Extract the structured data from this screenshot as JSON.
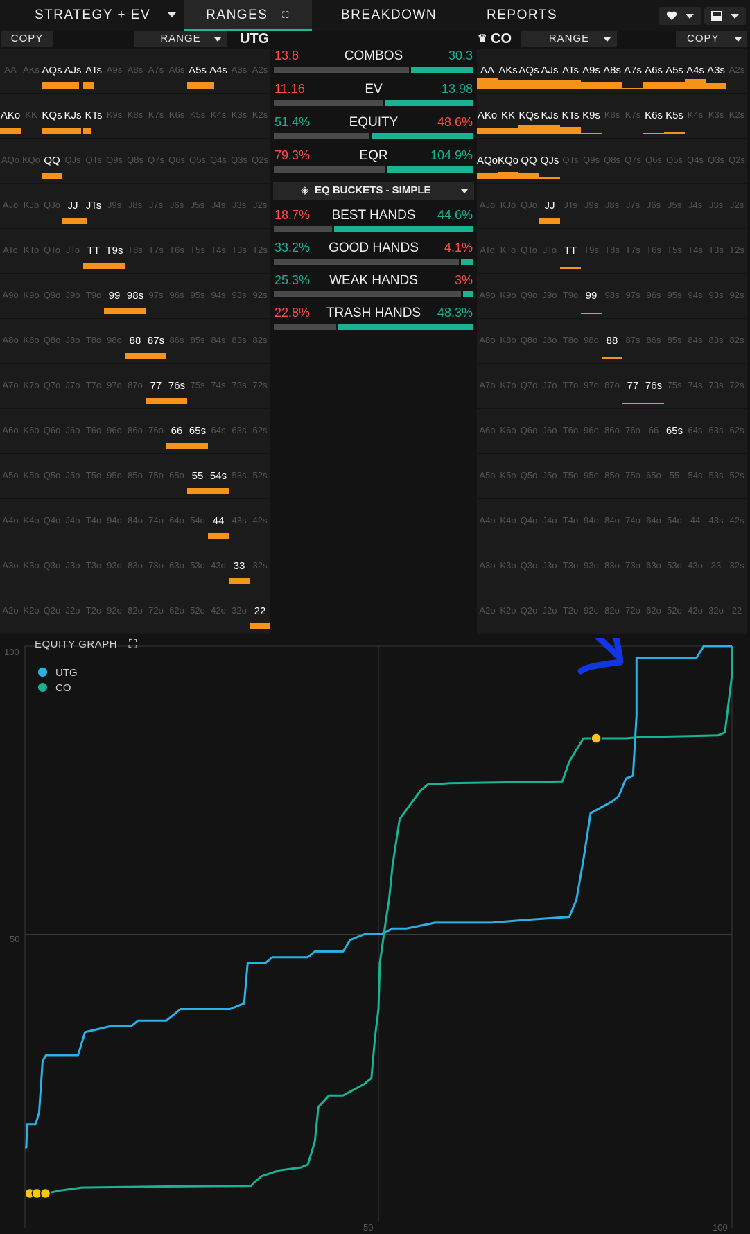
{
  "nav": {
    "tabs": [
      {
        "label": "STRATEGY + EV",
        "dropdown": true
      },
      {
        "label": "RANGES",
        "active": true
      },
      {
        "label": "BREAKDOWN"
      },
      {
        "label": "REPORTS"
      }
    ],
    "icons": [
      "heart-icon",
      "layout-icon"
    ]
  },
  "left": {
    "copy_label": "COPY",
    "range_label": "RANGE",
    "position": "UTG"
  },
  "right": {
    "copy_label": "COPY",
    "range_label": "RANGE",
    "position": "CO",
    "crown": "♛"
  },
  "hands": [
    [
      "AA",
      "AKs",
      "AQs",
      "AJs",
      "ATs",
      "A9s",
      "A8s",
      "A7s",
      "A6s",
      "A5s",
      "A4s",
      "A3s",
      "A2s"
    ],
    [
      "AKo",
      "KK",
      "KQs",
      "KJs",
      "KTs",
      "K9s",
      "K8s",
      "K7s",
      "K6s",
      "K5s",
      "K4s",
      "K3s",
      "K2s"
    ],
    [
      "AQo",
      "KQo",
      "QQ",
      "QJs",
      "QTs",
      "Q9s",
      "Q8s",
      "Q7s",
      "Q6s",
      "Q5s",
      "Q4s",
      "Q3s",
      "Q2s"
    ],
    [
      "AJo",
      "KJo",
      "QJo",
      "JJ",
      "JTs",
      "J9s",
      "J8s",
      "J7s",
      "J6s",
      "J5s",
      "J4s",
      "J3s",
      "J2s"
    ],
    [
      "ATo",
      "KTo",
      "QTo",
      "JTo",
      "TT",
      "T9s",
      "T8s",
      "T7s",
      "T6s",
      "T5s",
      "T4s",
      "T3s",
      "T2s"
    ],
    [
      "A9o",
      "K9o",
      "Q9o",
      "J9o",
      "T9o",
      "99",
      "98s",
      "97s",
      "96s",
      "95s",
      "94s",
      "93s",
      "92s"
    ],
    [
      "A8o",
      "K8o",
      "Q8o",
      "J8o",
      "T8o",
      "98o",
      "88",
      "87s",
      "86s",
      "85s",
      "84s",
      "83s",
      "82s"
    ],
    [
      "A7o",
      "K7o",
      "Q7o",
      "J7o",
      "T7o",
      "97o",
      "87o",
      "77",
      "76s",
      "75s",
      "74s",
      "73s",
      "72s"
    ],
    [
      "A6o",
      "K6o",
      "Q6o",
      "J6o",
      "T6o",
      "96o",
      "86o",
      "76o",
      "66",
      "65s",
      "64s",
      "63s",
      "62s"
    ],
    [
      "A5o",
      "K5o",
      "Q5o",
      "J5o",
      "T5o",
      "95o",
      "85o",
      "75o",
      "65o",
      "55",
      "54s",
      "53s",
      "52s"
    ],
    [
      "A4o",
      "K4o",
      "Q4o",
      "J4o",
      "T4o",
      "94o",
      "84o",
      "74o",
      "64o",
      "54o",
      "44",
      "43s",
      "42s"
    ],
    [
      "A3o",
      "K3o",
      "Q3o",
      "J3o",
      "T3o",
      "93o",
      "83o",
      "73o",
      "63o",
      "53o",
      "43o",
      "33",
      "32s"
    ],
    [
      "A2o",
      "K2o",
      "Q2o",
      "J2o",
      "T2o",
      "92o",
      "82o",
      "72o",
      "62o",
      "52o",
      "42o",
      "32o",
      "22"
    ]
  ],
  "utg_range": {
    "AQs": 1,
    "AJs": 0.8,
    "ATs": 0.5,
    "A5s": 1,
    "A4s": 0.3,
    "AKo": 1,
    "KQs": 1,
    "KJs": 0.9,
    "KTs": 0.4,
    "QQ": 1,
    "JJ": 1,
    "JTs": 0.2,
    "TT": 1,
    "T9s": 1,
    "99": 1,
    "98s": 1,
    "88": 1,
    "87s": 1,
    "77": 1,
    "76s": 1,
    "66": 1,
    "65s": 1,
    "55": 1,
    "54s": 1,
    "44": 1,
    "33": 1,
    "22": 1
  },
  "co_range": {
    "AA": 0.6,
    "AKs": 0.45,
    "AQs": 0.45,
    "AJs": 0.45,
    "ATs": 0.45,
    "A9s": 0.4,
    "A8s": 0.4,
    "A7s": 0.05,
    "A6s": 0.4,
    "A5s": 0.35,
    "A4s": 0.55,
    "A3s": 0.3,
    "AKo": 0.3,
    "KK": 0.3,
    "KQs": 0.45,
    "KJs": 0.45,
    "KTs": 0.4,
    "K9s": 0.05,
    "K6s": 0.05,
    "K5s": 0.1,
    "AQo": 0.3,
    "KQo": 0.4,
    "QQ": 0.3,
    "QJs": 0.1,
    "JJ": 0.3,
    "TT": 0.1,
    "99": 0.05,
    "88": 0.1,
    "77": 0.04,
    "76s": 0.04,
    "65s": 0.02
  },
  "stats": [
    {
      "left": "13.8",
      "label": "COMBOS",
      "right": "30.3",
      "lc": "red",
      "rc": "green",
      "fill": 0.31
    },
    {
      "left": "11.16",
      "label": "EV",
      "right": "13.98",
      "lc": "red",
      "rc": "green",
      "fill": 0.44
    },
    {
      "left": "51.4%",
      "label": "EQUITY",
      "right": "48.6%",
      "lc": "green",
      "rc": "red",
      "fill": 0.51
    },
    {
      "left": "79.3%",
      "label": "EQR",
      "right": "104.9%",
      "lc": "red",
      "rc": "green",
      "fill": 0.43
    }
  ],
  "eq_buckets_label": "EQ BUCKETS - SIMPLE",
  "buckets": [
    {
      "left": "18.7%",
      "label": "BEST HANDS",
      "right": "44.6%",
      "lc": "red",
      "rc": "green",
      "fill": 0.7
    },
    {
      "left": "33.2%",
      "label": "GOOD HANDS",
      "right": "4.1%",
      "lc": "green",
      "rc": "red",
      "fill": 0.06
    },
    {
      "left": "25.3%",
      "label": "WEAK HANDS",
      "right": "3%",
      "lc": "green",
      "rc": "red",
      "fill": 0.05
    },
    {
      "left": "22.8%",
      "label": "TRASH HANDS",
      "right": "48.3%",
      "lc": "red",
      "rc": "green",
      "fill": 0.68
    }
  ],
  "graph": {
    "title": "EQUITY GRAPH",
    "legend": [
      {
        "name": "UTG",
        "color": "#2ab1e8"
      },
      {
        "name": "CO",
        "color": "#19b394"
      }
    ],
    "y_ticks": [
      "100",
      "50"
    ],
    "x_ticks": [
      "50",
      "100"
    ]
  },
  "chart_data": {
    "type": "line",
    "title": "EQUITY GRAPH",
    "xlim": [
      0,
      100
    ],
    "ylim": [
      0,
      100
    ],
    "series": [
      {
        "name": "UTG",
        "points": [
          [
            0,
            13
          ],
          [
            0.2,
            13
          ],
          [
            0.3,
            17
          ],
          [
            1.5,
            17
          ],
          [
            2,
            19
          ],
          [
            2.5,
            28
          ],
          [
            3,
            29
          ],
          [
            7.5,
            29
          ],
          [
            8,
            31
          ],
          [
            8.5,
            33
          ],
          [
            12,
            34
          ],
          [
            15,
            34
          ],
          [
            16,
            35
          ],
          [
            20,
            35
          ],
          [
            22,
            37
          ],
          [
            29,
            37
          ],
          [
            31,
            38
          ],
          [
            31.5,
            45
          ],
          [
            34,
            45
          ],
          [
            35,
            46
          ],
          [
            40,
            46
          ],
          [
            41,
            47
          ],
          [
            45,
            47
          ],
          [
            46,
            49
          ],
          [
            48,
            50
          ],
          [
            50.5,
            50
          ],
          [
            52,
            51
          ],
          [
            54,
            51
          ],
          [
            58,
            52
          ],
          [
            66,
            52
          ],
          [
            71,
            52.5
          ],
          [
            77,
            53
          ],
          [
            78,
            56
          ],
          [
            79,
            63
          ],
          [
            80,
            71
          ],
          [
            83,
            73
          ],
          [
            84,
            74
          ],
          [
            85,
            77
          ],
          [
            86,
            77.5
          ],
          [
            86.5,
            88
          ],
          [
            86.5,
            98
          ],
          [
            95,
            98
          ],
          [
            96,
            100
          ],
          [
            100,
            100
          ]
        ]
      },
      {
        "name": "CO",
        "points": [
          [
            0,
            5
          ],
          [
            3,
            5
          ],
          [
            5,
            5.5
          ],
          [
            8,
            6
          ],
          [
            20,
            6.2
          ],
          [
            32,
            6.3
          ],
          [
            32.5,
            7
          ],
          [
            33.5,
            8
          ],
          [
            36,
            9
          ],
          [
            39,
            9.5
          ],
          [
            40,
            10
          ],
          [
            41,
            14
          ],
          [
            41.5,
            20
          ],
          [
            43,
            22
          ],
          [
            45,
            22
          ],
          [
            48,
            24
          ],
          [
            49,
            25
          ],
          [
            49.5,
            32
          ],
          [
            50,
            37
          ],
          [
            50.2,
            45
          ],
          [
            51,
            52
          ],
          [
            51.5,
            56
          ],
          [
            52,
            62
          ],
          [
            53,
            70
          ],
          [
            56,
            75
          ],
          [
            57,
            76
          ],
          [
            58,
            76
          ],
          [
            60,
            76.2
          ],
          [
            76,
            76.5
          ],
          [
            77,
            80
          ],
          [
            79,
            84
          ],
          [
            80,
            84
          ],
          [
            85,
            84
          ],
          [
            87,
            84.2
          ],
          [
            98,
            84.5
          ],
          [
            99,
            85
          ],
          [
            100,
            95
          ],
          [
            100,
            100
          ]
        ]
      }
    ]
  }
}
